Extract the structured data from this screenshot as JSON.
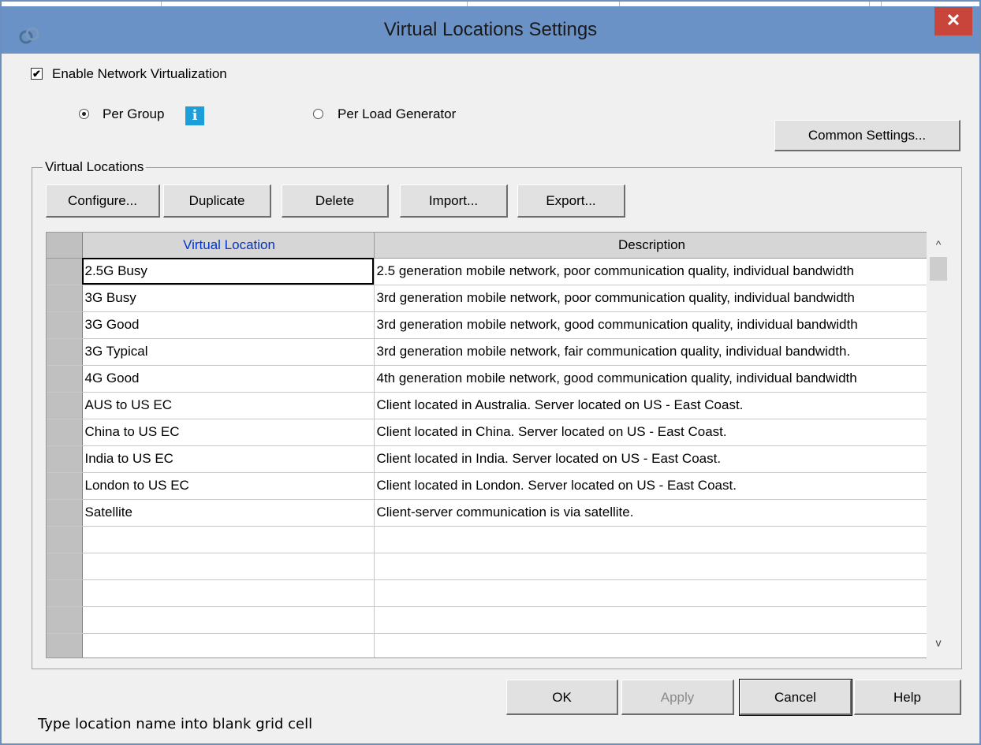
{
  "window": {
    "title": "Virtual Locations Settings",
    "close_glyph": "✕"
  },
  "enable_virtualization": {
    "label": "Enable Network Virtualization",
    "checked": true,
    "check_glyph": "✔"
  },
  "mode": {
    "per_group": {
      "label": "Per Group",
      "selected": true
    },
    "info_glyph": "i",
    "per_load_generator": {
      "label": "Per Load Generator",
      "selected": false
    }
  },
  "common_settings_label": "Common Settings...",
  "virtual_locations": {
    "group_label": "Virtual Locations",
    "toolbar": {
      "configure": "Configure...",
      "duplicate": "Duplicate",
      "delete": "Delete",
      "import": "Import...",
      "export": "Export..."
    },
    "columns": {
      "location": "Virtual Location",
      "description": "Description"
    },
    "rows": [
      {
        "location": "2.5G Busy",
        "description": "2.5 generation mobile network, poor communication quality, individual bandwidth"
      },
      {
        "location": "3G Busy",
        "description": "3rd generation mobile network, poor communication quality, individual bandwidth"
      },
      {
        "location": "3G Good",
        "description": "3rd generation mobile network, good communication quality, individual bandwidth"
      },
      {
        "location": "3G Typical",
        "description": "3rd generation mobile network, fair communication quality, individual bandwidth."
      },
      {
        "location": "4G Good",
        "description": "4th generation mobile network, good communication quality, individual bandwidth"
      },
      {
        "location": "AUS to US EC",
        "description": "Client located in Australia. Server located on US - East Coast."
      },
      {
        "location": "China to US EC",
        "description": "Client located in China. Server located on US - East Coast."
      },
      {
        "location": "India to US EC",
        "description": "Client located in India. Server located on US - East Coast."
      },
      {
        "location": "London to US EC",
        "description": "Client located in London. Server located on US - East Coast."
      },
      {
        "location": "Satellite",
        "description": "Client-server communication is via satellite."
      }
    ],
    "blank_rows": 5,
    "scroll_up_glyph": "^",
    "scroll_down_glyph": "v"
  },
  "footer": {
    "ok": "OK",
    "apply": "Apply",
    "cancel": "Cancel",
    "help": "Help",
    "status_text": "Type location name into blank grid cell"
  },
  "colors": {
    "title_bar": "#6b92c6",
    "close_button": "#c7453b",
    "info_icon": "#1e9ed9",
    "column_header_accent": "#0033cc"
  }
}
